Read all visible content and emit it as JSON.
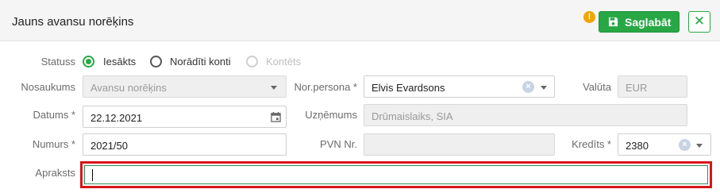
{
  "header": {
    "title": "Jauns avansu norēķins",
    "warning_glyph": "!",
    "save_label": "Saglabāt",
    "close_glyph": "✕"
  },
  "status": {
    "label": "Statuss",
    "options": [
      {
        "label": "Iesākts",
        "selected": true,
        "enabled": true
      },
      {
        "label": "Norādīti konti",
        "selected": false,
        "enabled": true
      },
      {
        "label": "Kontēts",
        "selected": false,
        "enabled": false
      }
    ]
  },
  "form": {
    "nosaukums": {
      "label": "Nosaukums",
      "value": "Avansu norēķins"
    },
    "nor_persona": {
      "label": "Nor.persona *",
      "value": "Elvis Evardsons"
    },
    "valuta": {
      "label": "Valūta",
      "value": "EUR"
    },
    "datums": {
      "label": "Datums *",
      "value": "22.12.2021"
    },
    "uznemums": {
      "label": "Uzņēmums",
      "value": "Drūmaislaiks, SIA"
    },
    "numurs": {
      "label": "Numurs *",
      "value": "2021/50"
    },
    "pvn_nr": {
      "label": "PVN Nr.",
      "value": ""
    },
    "kredits": {
      "label": "Kredīts *",
      "value": "2380"
    },
    "apraksts": {
      "label": "Apraksts",
      "value": ""
    }
  },
  "colors": {
    "accent": "#28a745",
    "warning": "#f0a500",
    "highlight": "#d9151b"
  }
}
